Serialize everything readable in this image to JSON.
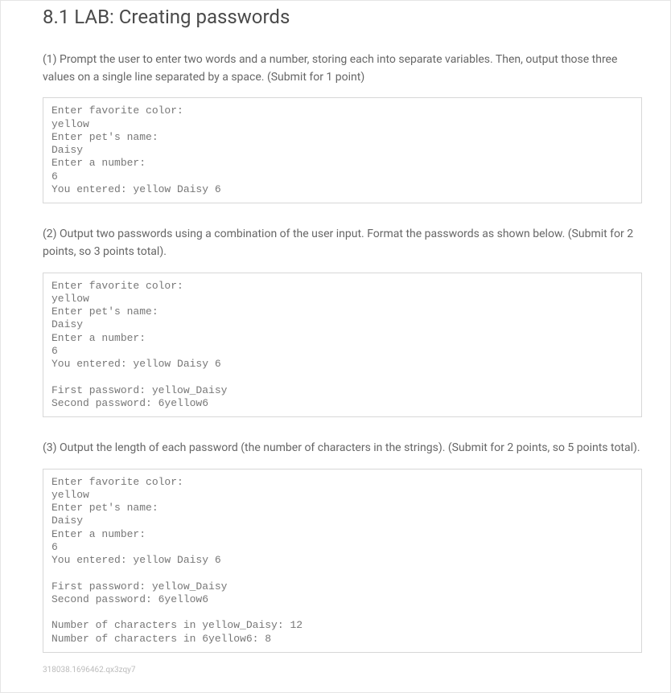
{
  "heading": "8.1 LAB: Creating passwords",
  "section1": {
    "desc": "(1) Prompt the user to enter two words and a number, storing each into separate variables. Then, output those three values on a single line separated by a space. (Submit for 1 point)",
    "code": "Enter favorite color:\nyellow\nEnter pet's name:\nDaisy\nEnter a number:\n6\nYou entered: yellow Daisy 6"
  },
  "section2": {
    "desc": "(2) Output two passwords using a combination of the user input. Format the passwords as shown below. (Submit for 2 points, so 3 points total).",
    "code": "Enter favorite color:\nyellow\nEnter pet's name:\nDaisy\nEnter a number:\n6\nYou entered: yellow Daisy 6\n\nFirst password: yellow_Daisy\nSecond password: 6yellow6"
  },
  "section3": {
    "desc": "(3) Output the length of each password (the number of characters in the strings). (Submit for 2 points, so 5 points total).",
    "code": "Enter favorite color:\nyellow\nEnter pet's name:\nDaisy\nEnter a number:\n6\nYou entered: yellow Daisy 6\n\nFirst password: yellow_Daisy\nSecond password: 6yellow6\n\nNumber of characters in yellow_Daisy: 12\nNumber of characters in 6yellow6: 8"
  },
  "footerId": "318038.1696462.qx3zqy7"
}
